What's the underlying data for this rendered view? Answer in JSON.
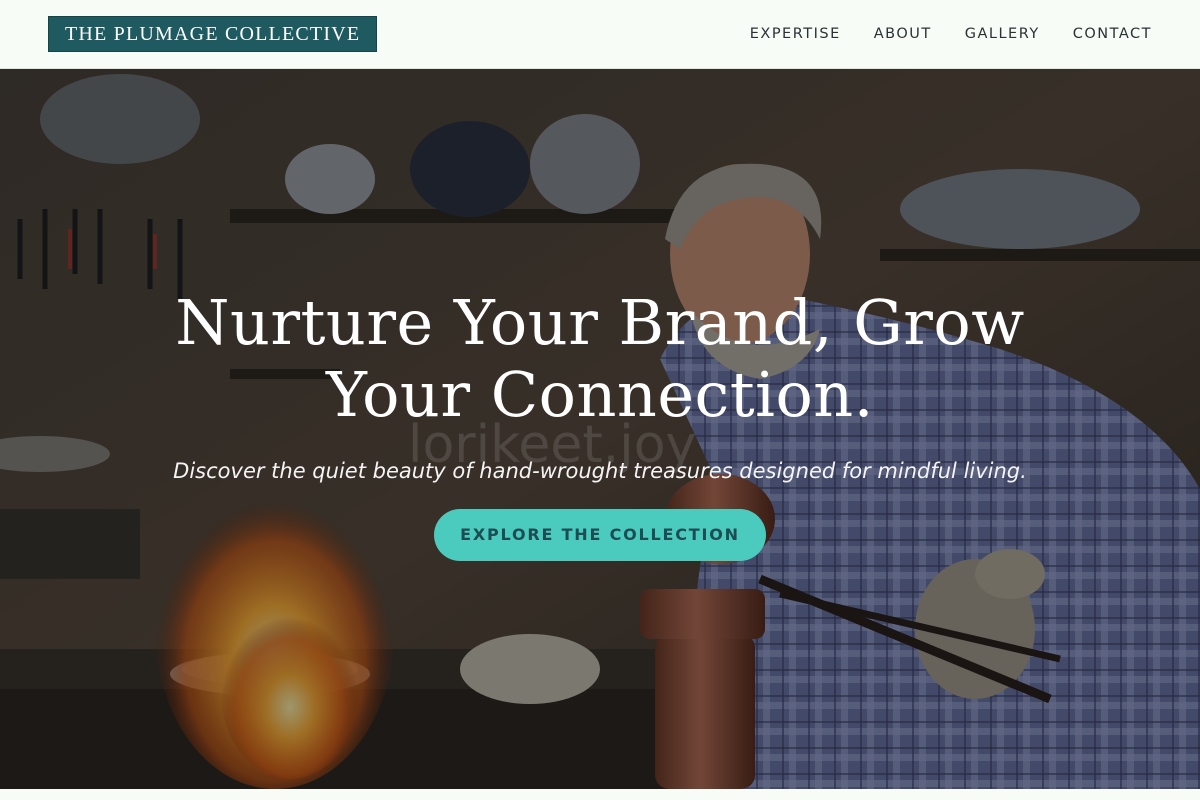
{
  "header": {
    "logo": "THE PLUMAGE COLLECTIVE",
    "nav": [
      "EXPERTISE",
      "ABOUT",
      "GALLERY",
      "CONTACT"
    ]
  },
  "hero": {
    "title": "Nurture Your Brand, Grow Your Connection.",
    "subtitle": "Discover the quiet beauty of hand-wrought treasures designed for mindful living.",
    "cta_label": "EXPLORE THE COLLECTION",
    "watermark": "lorikeet.joy"
  },
  "colors": {
    "header_bg": "#f7fcf6",
    "logo_bg": "#1e5a60",
    "cta_bg": "#4bcabe",
    "cta_text": "#1d4c52"
  }
}
